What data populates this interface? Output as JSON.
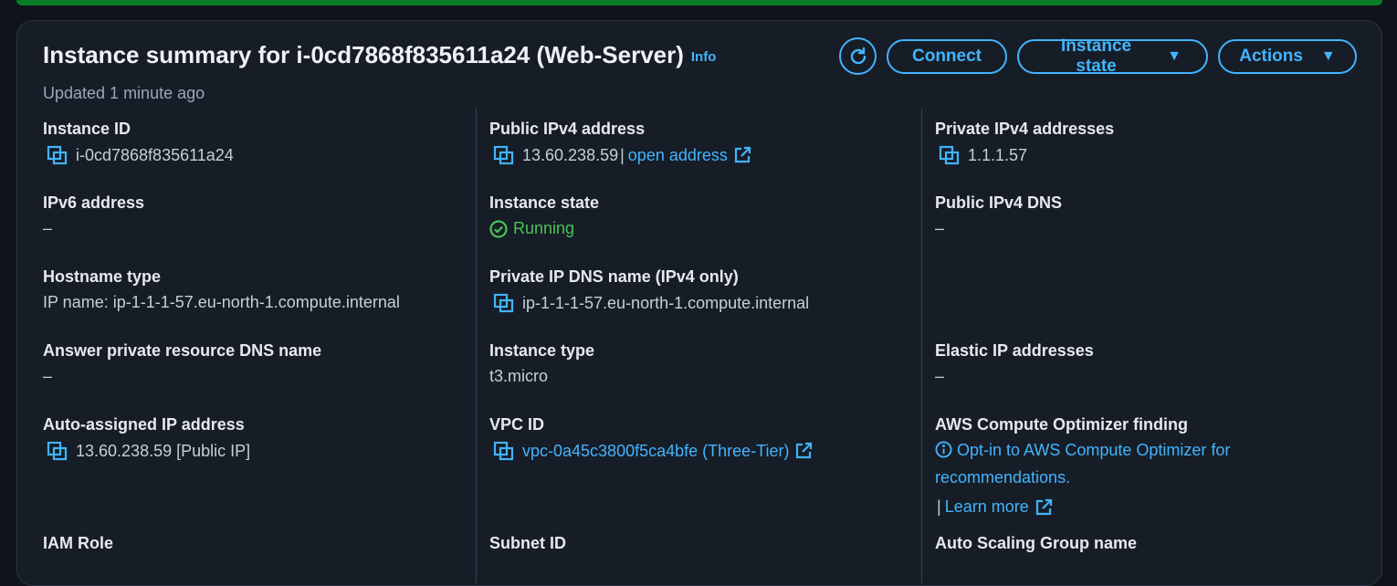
{
  "title": "Instance summary for i-0cd7868f835611a24 (Web-Server)",
  "info_label": "Info",
  "updated": "Updated 1 minute ago",
  "buttons": {
    "connect": "Connect",
    "instance_state": "Instance state",
    "actions": "Actions"
  },
  "col1": {
    "instance_id": {
      "label": "Instance ID",
      "value": "i-0cd7868f835611a24"
    },
    "ipv6": {
      "label": "IPv6 address",
      "value": "–"
    },
    "hostname_type": {
      "label": "Hostname type",
      "value": "IP name: ip-1-1-1-57.eu-north-1.compute.internal"
    },
    "answer_dns": {
      "label": "Answer private resource DNS name",
      "value": "–"
    },
    "auto_ip": {
      "label": "Auto-assigned IP address",
      "value": "13.60.238.59 [Public IP]"
    },
    "iam_role": {
      "label": "IAM Role"
    }
  },
  "col2": {
    "public_ipv4": {
      "label": "Public IPv4 address",
      "value": "13.60.238.59",
      "sep": "|",
      "link": "open address"
    },
    "state": {
      "label": "Instance state",
      "value": "Running"
    },
    "private_dns": {
      "label": "Private IP DNS name (IPv4 only)",
      "value": "ip-1-1-1-57.eu-north-1.compute.internal"
    },
    "type": {
      "label": "Instance type",
      "value": "t3.micro"
    },
    "vpc": {
      "label": "VPC ID",
      "value": "vpc-0a45c3800f5ca4bfe (Three-Tier)"
    },
    "subnet": {
      "label": "Subnet ID"
    }
  },
  "col3": {
    "private_ipv4": {
      "label": "Private IPv4 addresses",
      "value": "1.1.1.57"
    },
    "public_dns": {
      "label": "Public IPv4 DNS",
      "value": "–"
    },
    "elastic_ip": {
      "label": "Elastic IP addresses",
      "value": "–"
    },
    "optimizer": {
      "label": "AWS Compute Optimizer finding",
      "value": "Opt-in to AWS Compute Optimizer for recommendations.",
      "sep": "|",
      "learn_more": "Learn more"
    },
    "asg": {
      "label": "Auto Scaling Group name"
    }
  },
  "colors": {
    "accent": "#42b4ff",
    "running": "#47c35a",
    "status_bar": "#0a7d2a"
  }
}
